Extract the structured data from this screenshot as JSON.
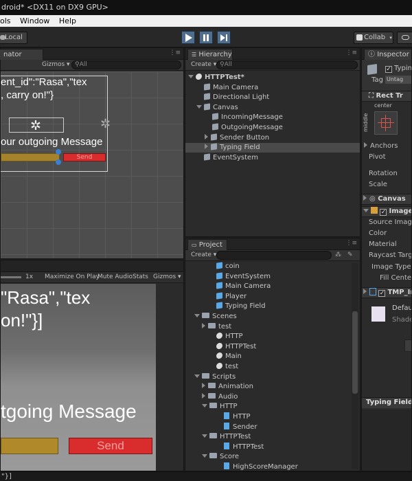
{
  "window": {
    "title": "droid* <DX11 on DX9 GPU>"
  },
  "menu": [
    "ols",
    "Window",
    "Help"
  ],
  "toolbar": {
    "account": "Local",
    "collab": "Collab"
  },
  "scene": {
    "tab": "nator",
    "gizmos": "Gizmos",
    "search": "All",
    "text_line1": "ent_id\":\"Rasa\",\"tex",
    "text_line2": ", carry on!\"}",
    "input_placeholder": "our outgoing Message",
    "send": "Send"
  },
  "game": {
    "scale": "1x",
    "maximize": "Maximize On Play",
    "mute": "Mute Audio",
    "stats": "Stats",
    "gizmos": "Gizmos",
    "text_line1": "\"Rasa\",\"tex",
    "text_line2": "on!\"}]",
    "input_placeholder": "tgoing Message",
    "send": "Send"
  },
  "hierarchy": {
    "tab": "Hierarchy",
    "create": "Create",
    "search": "All",
    "items": [
      {
        "label": "HTTPTest*",
        "level": 0,
        "icon": "unity",
        "expand": "down",
        "selected": false
      },
      {
        "label": "Main Camera",
        "level": 1,
        "icon": "cube",
        "expand": "",
        "selected": false
      },
      {
        "label": "Directional Light",
        "level": 1,
        "icon": "cube",
        "expand": "",
        "selected": false
      },
      {
        "label": "Canvas",
        "level": 1,
        "icon": "cube",
        "expand": "down",
        "selected": false
      },
      {
        "label": "IncomingMessage",
        "level": 2,
        "icon": "cube",
        "expand": "",
        "selected": false
      },
      {
        "label": "OutgoingMessage",
        "level": 2,
        "icon": "cube",
        "expand": "",
        "selected": false
      },
      {
        "label": "Sender Button",
        "level": 2,
        "icon": "cube",
        "expand": "right",
        "selected": false
      },
      {
        "label": "Typing Field",
        "level": 2,
        "icon": "cube",
        "expand": "right",
        "selected": true
      },
      {
        "label": "EventSystem",
        "level": 1,
        "icon": "cube",
        "expand": "",
        "selected": false
      }
    ]
  },
  "project": {
    "tab": "Project",
    "create": "Create",
    "items": [
      {
        "label": "coin",
        "level": 3,
        "icon": "cube"
      },
      {
        "label": "EventSystem",
        "level": 3,
        "icon": "cube"
      },
      {
        "label": "Main Camera",
        "level": 3,
        "icon": "cube"
      },
      {
        "label": "Player",
        "level": 3,
        "icon": "cube"
      },
      {
        "label": "Typing Field",
        "level": 3,
        "icon": "cube"
      },
      {
        "label": "Scenes",
        "level": 1,
        "icon": "folder",
        "expand": "down"
      },
      {
        "label": "test",
        "level": 2,
        "icon": "folder",
        "expand": "right"
      },
      {
        "label": "HTTP",
        "level": 3,
        "icon": "unity"
      },
      {
        "label": "HTTPTest",
        "level": 3,
        "icon": "unity"
      },
      {
        "label": "Main",
        "level": 3,
        "icon": "unity"
      },
      {
        "label": "test",
        "level": 3,
        "icon": "unity"
      },
      {
        "label": "Scripts",
        "level": 1,
        "icon": "folder",
        "expand": "down"
      },
      {
        "label": "Animation",
        "level": 2,
        "icon": "folder",
        "expand": "right"
      },
      {
        "label": "Audio",
        "level": 2,
        "icon": "folder",
        "expand": "right"
      },
      {
        "label": "HTTP",
        "level": 2,
        "icon": "folder",
        "expand": "down"
      },
      {
        "label": "HTTP",
        "level": 4,
        "icon": "script"
      },
      {
        "label": "Sender",
        "level": 4,
        "icon": "script"
      },
      {
        "label": "HTTPTest",
        "level": 2,
        "icon": "folder",
        "expand": "down"
      },
      {
        "label": "HTTPTest",
        "level": 4,
        "icon": "script"
      },
      {
        "label": "Score",
        "level": 2,
        "icon": "folder",
        "expand": "down"
      },
      {
        "label": "HighScoreManager",
        "level": 4,
        "icon": "script"
      }
    ]
  },
  "inspector": {
    "tab": "Inspector",
    "object_name": "Typin",
    "tag_label": "Tag",
    "tag_value": "Untag",
    "rect_transform": "Rect Tr",
    "anchor_preset": "center",
    "middle": "middle",
    "anchors": "Anchors",
    "pivot": "Pivot",
    "rotation": "Rotation",
    "scale": "Scale",
    "canvas": "Canvas",
    "image": "Image",
    "source_image": "Source Image",
    "color": "Color",
    "material": "Material",
    "raycast": "Raycast Targe",
    "image_type": "Image Type",
    "fill_center": "Fill Center",
    "tmp": "TMP_In",
    "default": "Defaul",
    "shader": "Shade",
    "footer": "Typing Field"
  },
  "status": {
    "text": "\"}]"
  }
}
